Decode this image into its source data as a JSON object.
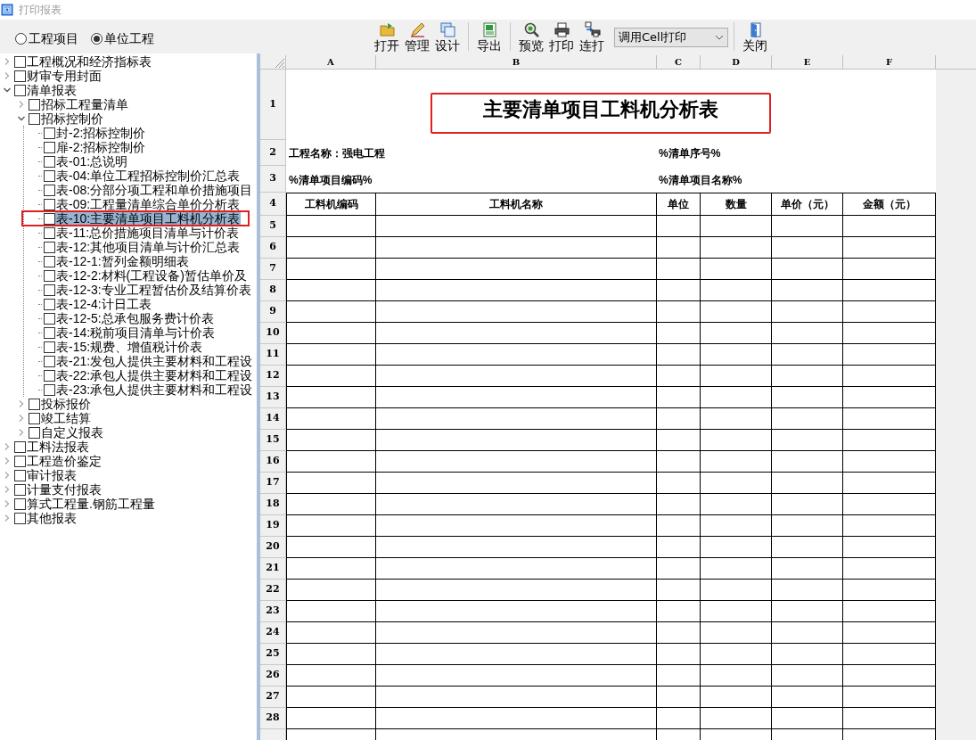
{
  "window": {
    "title": "打印报表"
  },
  "scope_options": [
    {
      "label": "工程项目",
      "selected": false
    },
    {
      "label": "单位工程",
      "selected": true
    }
  ],
  "toolbar": [
    {
      "kind": "button",
      "label": "打开"
    },
    {
      "kind": "button",
      "label": "管理"
    },
    {
      "kind": "button",
      "label": "设计"
    },
    {
      "kind": "separator"
    },
    {
      "kind": "button",
      "label": "导出"
    },
    {
      "kind": "separator"
    },
    {
      "kind": "button",
      "label": "预览"
    },
    {
      "kind": "button",
      "label": "打印"
    },
    {
      "kind": "button",
      "label": "连打"
    },
    {
      "kind": "dropdown",
      "value": "调用Cell打印"
    },
    {
      "kind": "separator"
    },
    {
      "kind": "button",
      "label": "关闭"
    }
  ],
  "tree": [
    {
      "label": "工程概况和经济指标表",
      "checked": false,
      "expanded": false
    },
    {
      "label": "财审专用封面",
      "checked": false,
      "expanded": false
    },
    {
      "label": "清单报表",
      "checked": false,
      "expanded": true,
      "children": [
        {
          "label": "招标工程量清单",
          "checked": false,
          "expanded": false
        },
        {
          "label": "招标控制价",
          "checked": false,
          "expanded": true,
          "children": [
            {
              "label": "封-2:招标控制价",
              "checked": false,
              "selected": false,
              "marked": false
            },
            {
              "label": "扉-2:招标控制价",
              "checked": false,
              "selected": false,
              "marked": false
            },
            {
              "label": "表-01:总说明",
              "checked": false,
              "selected": false,
              "marked": false
            },
            {
              "label": "表-04:单位工程招标控制价汇总表",
              "checked": false,
              "selected": false,
              "marked": false
            },
            {
              "label": "表-08:分部分项工程和单价措施项目",
              "checked": false,
              "selected": false,
              "marked": false
            },
            {
              "label": "表-09:工程量清单综合单价分析表",
              "checked": false,
              "selected": false,
              "marked": false
            },
            {
              "label": "表-10:主要清单项目工料机分析表",
              "checked": false,
              "selected": true,
              "marked": true
            },
            {
              "label": "表-11:总价措施项目清单与计价表",
              "checked": false,
              "selected": false,
              "marked": false
            },
            {
              "label": "表-12:其他项目清单与计价汇总表",
              "checked": false,
              "selected": false,
              "marked": false
            },
            {
              "label": "表-12-1:暂列金额明细表",
              "checked": false,
              "selected": false,
              "marked": false
            },
            {
              "label": "表-12-2:材料(工程设备)暂估单价及",
              "checked": false,
              "selected": false,
              "marked": false
            },
            {
              "label": "表-12-3:专业工程暂估价及结算价表",
              "checked": false,
              "selected": false,
              "marked": false
            },
            {
              "label": "表-12-4:计日工表",
              "checked": false,
              "selected": false,
              "marked": false
            },
            {
              "label": "表-12-5:总承包服务费计价表",
              "checked": false,
              "selected": false,
              "marked": false
            },
            {
              "label": "表-14:税前项目清单与计价表",
              "checked": false,
              "selected": false,
              "marked": false
            },
            {
              "label": "表-15:规费、增值税计价表",
              "checked": false,
              "selected": false,
              "marked": false
            },
            {
              "label": "表-21:发包人提供主要材料和工程设",
              "checked": false,
              "selected": false,
              "marked": false
            },
            {
              "label": "表-22:承包人提供主要材料和工程设",
              "checked": false,
              "selected": false,
              "marked": false
            },
            {
              "label": "表-23:承包人提供主要材料和工程设",
              "checked": false,
              "selected": false,
              "marked": false
            }
          ]
        },
        {
          "label": "投标报价",
          "checked": false,
          "expanded": false
        },
        {
          "label": "竣工结算",
          "checked": false,
          "expanded": false
        },
        {
          "label": "自定义报表",
          "checked": false,
          "expanded": false
        }
      ]
    },
    {
      "label": "工料法报表",
      "checked": false,
      "expanded": false
    },
    {
      "label": "工程造价鉴定",
      "checked": false,
      "expanded": false
    },
    {
      "label": "审计报表",
      "checked": false,
      "expanded": false
    },
    {
      "label": "计量支付报表",
      "checked": false,
      "expanded": false
    },
    {
      "label": "算式工程量.钢筋工程量",
      "checked": false,
      "expanded": false
    },
    {
      "label": "其他报表",
      "checked": false,
      "expanded": false
    }
  ],
  "sheet": {
    "columns": [
      "A",
      "B",
      "C",
      "D",
      "E",
      "F"
    ],
    "row_numbers": [
      "1",
      "2",
      "3",
      "4",
      "5",
      "6",
      "7",
      "8",
      "9",
      "10",
      "11",
      "12",
      "13",
      "14",
      "15",
      "16",
      "17",
      "18",
      "19",
      "20",
      "21",
      "22",
      "23",
      "24",
      "25",
      "26",
      "27",
      "28"
    ],
    "title": {
      "text": "主要清单项目工料机分析表",
      "marked": true
    },
    "info_rows": [
      [
        "工程名称：强电工程",
        "%清单序号%"
      ],
      [
        "%清单项目编码%",
        "%清单项目名称%"
      ]
    ],
    "table_headers": [
      "工料机编码",
      "工料机名称",
      "单位",
      "数量",
      "单价（元）",
      "金额（元）"
    ]
  }
}
